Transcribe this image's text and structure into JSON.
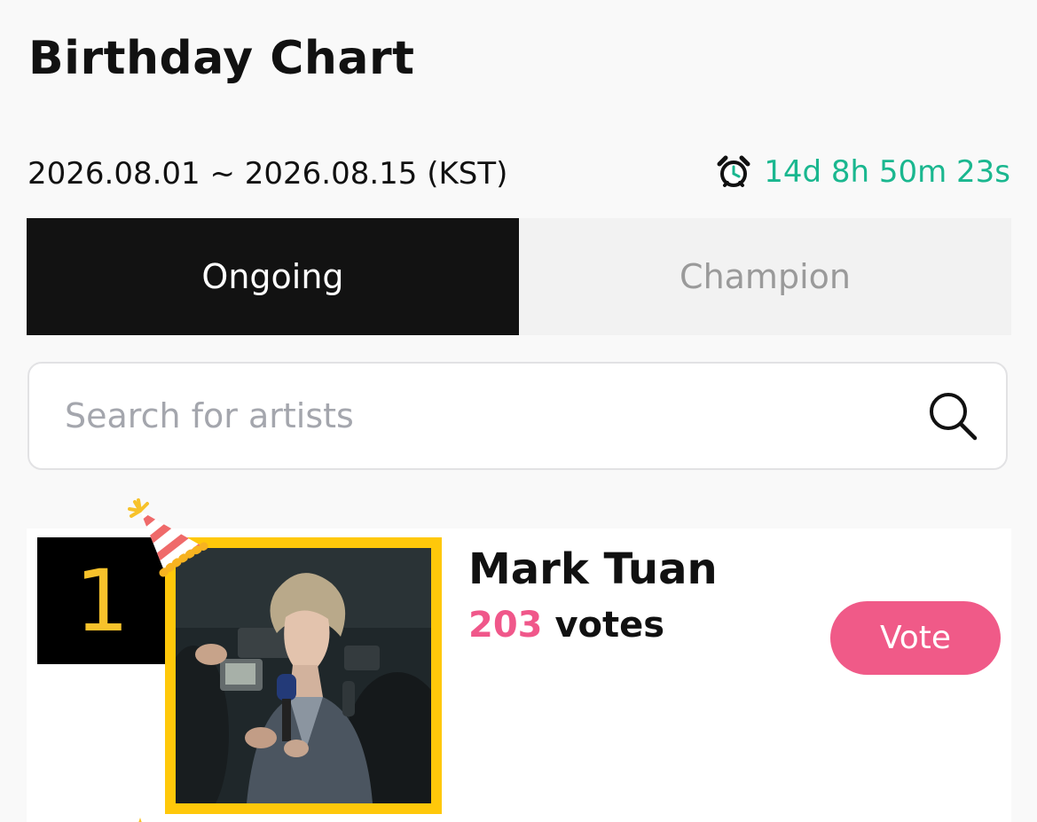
{
  "header": {
    "title": "Birthday Chart"
  },
  "period": {
    "range": "2026.08.01 ~ 2026.08.15 (KST)",
    "countdown": "14d 8h 50m 23s",
    "countdown_icon": "alarm-clock-icon",
    "accent_color": "#1ab78f"
  },
  "tabs": [
    {
      "label": "Ongoing",
      "active": true
    },
    {
      "label": "Champion",
      "active": false
    }
  ],
  "search": {
    "placeholder": "Search for artists",
    "value": "",
    "icon": "search-icon"
  },
  "ranking": [
    {
      "rank": "1",
      "name": "Mark Tuan",
      "vote_count": "203",
      "vote_unit": "votes",
      "vote_button_label": "Vote",
      "badge_icon": "party-hat-icon",
      "frame_color": "#ffc80a",
      "vote_color": "#f05a88"
    }
  ]
}
